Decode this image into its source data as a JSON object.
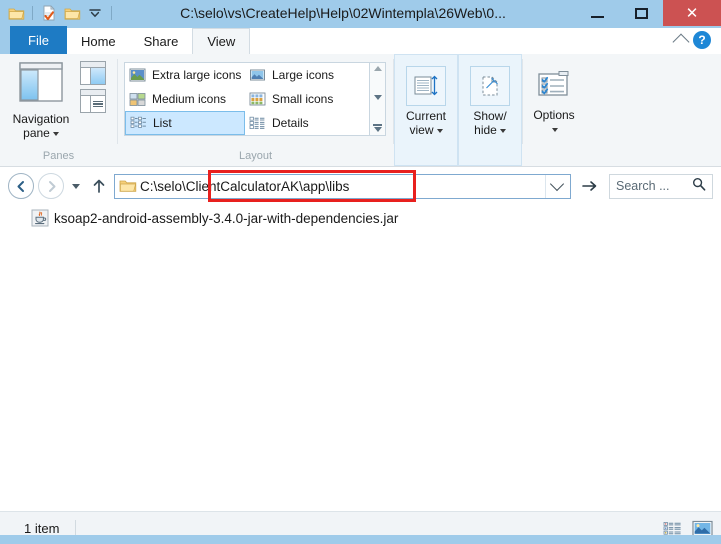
{
  "window": {
    "title": "C:\\selo\\vs\\CreateHelp\\Help\\02Wintempla\\26Web\\0...",
    "quick_access": [
      {
        "name": "folder-icon",
        "label": "Folder"
      },
      {
        "name": "properties-icon",
        "label": "Properties"
      },
      {
        "name": "new-folder-icon",
        "label": "New folder"
      },
      {
        "name": "customize-quick-access-icon",
        "label": "Customize Quick Access Toolbar"
      }
    ],
    "caption": {
      "minimize": "Minimize",
      "maximize": "Maximize",
      "close": "Close"
    },
    "accent_titlebar": "#9fcbea",
    "close_color": "#cc5252"
  },
  "ribbon": {
    "tabs": [
      {
        "label": "File",
        "state": "file"
      },
      {
        "label": "Home",
        "state": "normal"
      },
      {
        "label": "Share",
        "state": "normal"
      },
      {
        "label": "View",
        "state": "active"
      }
    ],
    "collapse_label": "Minimize the Ribbon",
    "help_label": "?",
    "groups": [
      {
        "name": "panes",
        "label": "Panes",
        "navigation_pane": {
          "line1": "Navigation",
          "line2": "pane"
        },
        "mini_buttons": [
          "preview-pane",
          "details-pane"
        ]
      },
      {
        "name": "layout",
        "label": "Layout",
        "items": [
          {
            "label": "Extra large icons",
            "selected": false
          },
          {
            "label": "Large icons",
            "selected": false
          },
          {
            "label": "Medium icons",
            "selected": false
          },
          {
            "label": "Small icons",
            "selected": false
          },
          {
            "label": "List",
            "selected": true
          },
          {
            "label": "Details",
            "selected": false
          }
        ],
        "scroll": [
          "scroll-up",
          "scroll-down",
          "more-layouts"
        ]
      },
      {
        "name": "current-view",
        "label": "",
        "button": {
          "line1": "Current",
          "line2": "view"
        }
      },
      {
        "name": "show-hide",
        "label": "",
        "button": {
          "line1": "Show/",
          "line2": "hide"
        }
      },
      {
        "name": "options",
        "label": "",
        "button": {
          "line1": "Options",
          "line2": ""
        }
      }
    ]
  },
  "address_bar": {
    "back_label": "Back",
    "forward_label": "Forward",
    "recent_label": "Recent locations",
    "up_label": "Up one level",
    "path_text": "C:\\selo\\ClientCalculatorAK\\app\\libs",
    "dropdown_label": "Previous locations",
    "go_label": "Refresh",
    "search_placeholder": "Search ...",
    "highlight_color": "#e8201e",
    "highlight_target": "\\ClientCalculatorAK\\app\\libs"
  },
  "content": {
    "files": [
      {
        "name": "ksoap2-android-assembly-3.4.0-jar-with-dependencies.jar",
        "icon": "java-jar-icon"
      }
    ]
  },
  "status_bar": {
    "item_count": "1 item",
    "view_buttons": [
      {
        "name": "details-view-button",
        "label": "Details view"
      },
      {
        "name": "large-icons-view-button",
        "label": "Large icons view"
      }
    ]
  }
}
